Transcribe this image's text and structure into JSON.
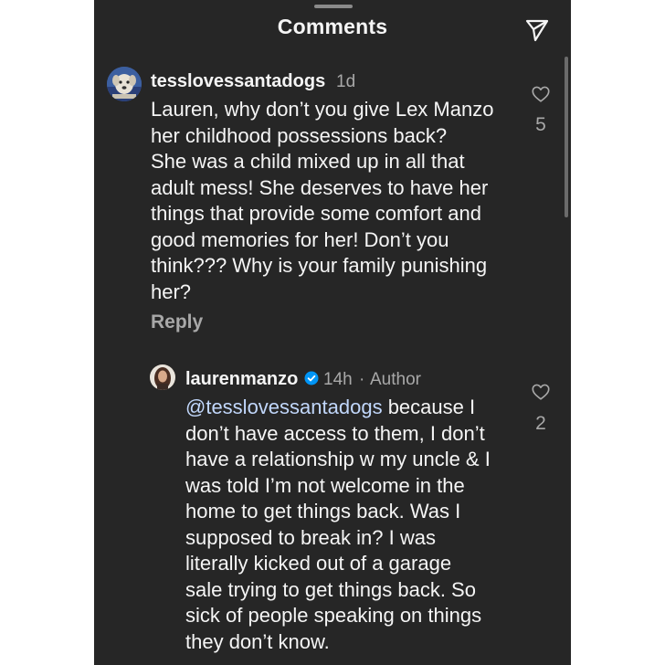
{
  "header": {
    "title": "Comments"
  },
  "comments": [
    {
      "username": "tesslovessantadogs",
      "time": "1d",
      "text": "Lauren, why don’t you give Lex Manzo\nher childhood possessions back?\nShe was a child mixed up in all that\nadult mess!  She deserves to have her\nthings that provide some comfort and\ngood memories for her!  Don’t you\nthink??? Why is your family punishing\nher?",
      "likes": "5",
      "reply_label": "Reply"
    }
  ],
  "replies": [
    {
      "username": "laurenmanzo",
      "verified": true,
      "time": "14h",
      "separator": "·",
      "author_label": "Author",
      "mention": "@tesslovessantadogs",
      "text": " because I\ndon’t have access to them, I don’t\nhave a relationship w my uncle & I\nwas told I’m not welcome in the\nhome to get things back. Was I\nsupposed to break in? I was\nliterally kicked out of a garage\nsale trying to get things back. So\nsick of people speaking on things\nthey don’t know.",
      "likes": "2"
    }
  ],
  "icons": {
    "send": "paper-plane-icon",
    "like": "heart-outline-icon",
    "verified": "verified-badge-icon"
  },
  "colors": {
    "background": "#262626",
    "text": "#f5f5f5",
    "secondary": "#a8a8a8",
    "mention": "#c1d7fb",
    "verified": "#0095f6"
  }
}
